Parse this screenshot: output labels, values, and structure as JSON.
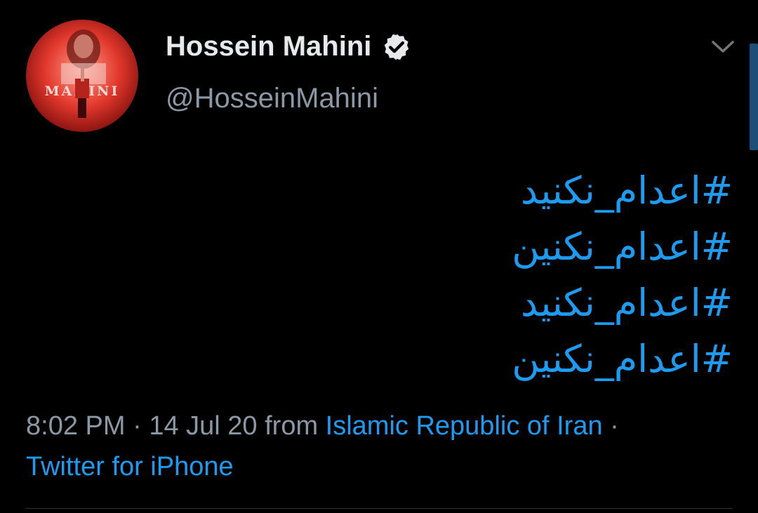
{
  "author": {
    "name": "Hossein Mahini",
    "handle": "@HosseinMahini",
    "verified": true,
    "avatar_text": "MAHINI"
  },
  "tweet": {
    "hashtags": [
      "#اعدام_نکنید",
      "#اعدام_نکنین",
      "#اعدام_نکنید",
      "#اعدام_نکنین"
    ]
  },
  "meta": {
    "time": "8:02 PM",
    "separator": "·",
    "date": "14 Jul 20",
    "from_text": "from",
    "location": "Islamic Republic of Iran",
    "source": "Twitter for iPhone"
  },
  "icons": {
    "verified": "verified-badge-icon",
    "menu": "chevron-down-icon"
  },
  "colors": {
    "background": "#000000",
    "link": "#1d9bf0",
    "muted": "#8b98a5",
    "name": "#e7e9ea"
  }
}
